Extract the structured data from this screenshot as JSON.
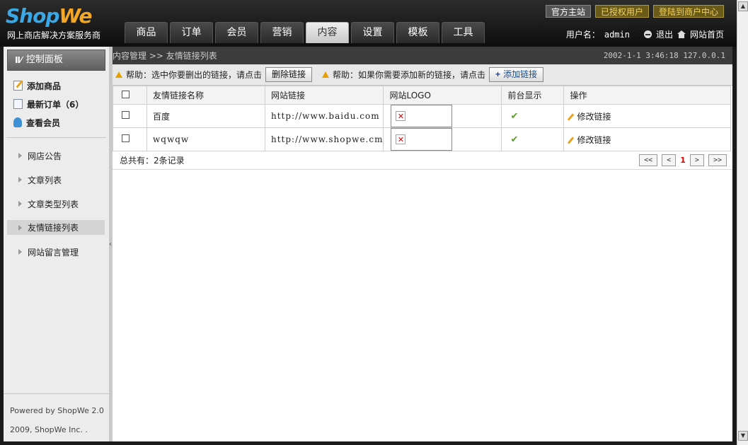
{
  "brand": {
    "logo_shop": "Shop",
    "logo_we": "We",
    "slogan": "网上商店解决方案服务商"
  },
  "top_links": [
    {
      "label": "官方主站",
      "style": "grey"
    },
    {
      "label": "已授权用户",
      "style": "gold"
    },
    {
      "label": "登陆到商户中心",
      "style": "gold"
    }
  ],
  "nav": {
    "tabs": [
      "商品",
      "订单",
      "会员",
      "营销",
      "内容",
      "设置",
      "模板",
      "工具"
    ],
    "active": "内容"
  },
  "user": {
    "label": "用户名：",
    "name": "admin",
    "logout": "退出",
    "home": "网站首页"
  },
  "sidebar": {
    "panel_title": "控制面板",
    "quick": [
      {
        "label": "添加商品",
        "icon": "edit-icon"
      },
      {
        "label": "最新订单（6）",
        "icon": "document-icon"
      },
      {
        "label": "查看会员",
        "icon": "user-icon"
      }
    ],
    "items": [
      {
        "label": "网店公告"
      },
      {
        "label": "文章列表"
      },
      {
        "label": "文章类型列表"
      },
      {
        "label": "友情链接列表"
      },
      {
        "label": "网站留言管理"
      }
    ],
    "active_item": "友情链接列表",
    "footer_line1": "Powered by ShopWe 2.0",
    "footer_line2": "2009, ShopWe Inc. ."
  },
  "breadcrumb": {
    "text": "内容管理 >> 友情链接列表",
    "status": "2002-1-1 3:46:18 127.0.0.1"
  },
  "help": {
    "delete_hint": "帮助：选中你要删出的链接，请点击",
    "delete_btn": "删除链接",
    "add_hint": "帮助：如果你需要添加新的链接，请点击",
    "add_btn": "添加链接"
  },
  "table": {
    "headers": [
      "友情链接名称",
      "网站链接",
      "网站LOGO",
      "前台显示",
      "操作"
    ],
    "rows": [
      {
        "name": "百度",
        "url": "http://www.baidu.com",
        "visible": "✔",
        "action": "修改链接"
      },
      {
        "name": "wqwqw",
        "url": "http://www.shopwe.cm",
        "visible": "✔",
        "action": "修改链接"
      }
    ]
  },
  "summary": "总共有：2条记录",
  "pager": {
    "first": "<<",
    "prev": "<",
    "current": "1",
    "next": ">",
    "last": ">>"
  },
  "colors": {
    "accent_gold": "#f3d35a",
    "logo_blue": "#3aa7e6",
    "logo_orange": "#f5a623",
    "current_page": "#dd0000"
  }
}
